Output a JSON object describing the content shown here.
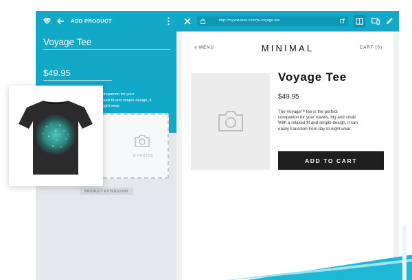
{
  "admin": {
    "title": "ADD PRODUCT",
    "product_name": "Voyage Tee",
    "product_price": "$49.95",
    "description_lines": [
      "The Voyage™ tee is the perfect companion for your",
      "relaxed fit and simple design, it",
      "to night wear."
    ],
    "photos_label": "D PHOTOS",
    "extensions_label": "PRODUCT EXTENSIONS",
    "accent_color": "#12a8c7"
  },
  "browser": {
    "url": "http://myvolusion.com/p/-voyage-tee"
  },
  "shop": {
    "menu_label": "≡ MENU",
    "brand": "MINIMAL",
    "cart_label": "CART (0)",
    "product_title": "Voyage Tee",
    "product_price": "$49.95",
    "description_lines": [
      "The Voyage™ tee is the perfect",
      "companion for your travels, big and small.",
      "With a relaxed fit and simple design, it can",
      "easily transition from day to night wear."
    ],
    "add_to_cart_label": "ADD TO CART"
  },
  "icons": {
    "logo": "diamond-logo-icon",
    "back": "arrow-left-icon",
    "more": "kebab-icon",
    "close": "close-icon",
    "lock": "lock-icon",
    "external": "external-link-icon",
    "desktop": "desktop-preview-icon",
    "mobile": "mobile-preview-icon",
    "edit": "pencil-icon",
    "camera": "camera-icon"
  }
}
